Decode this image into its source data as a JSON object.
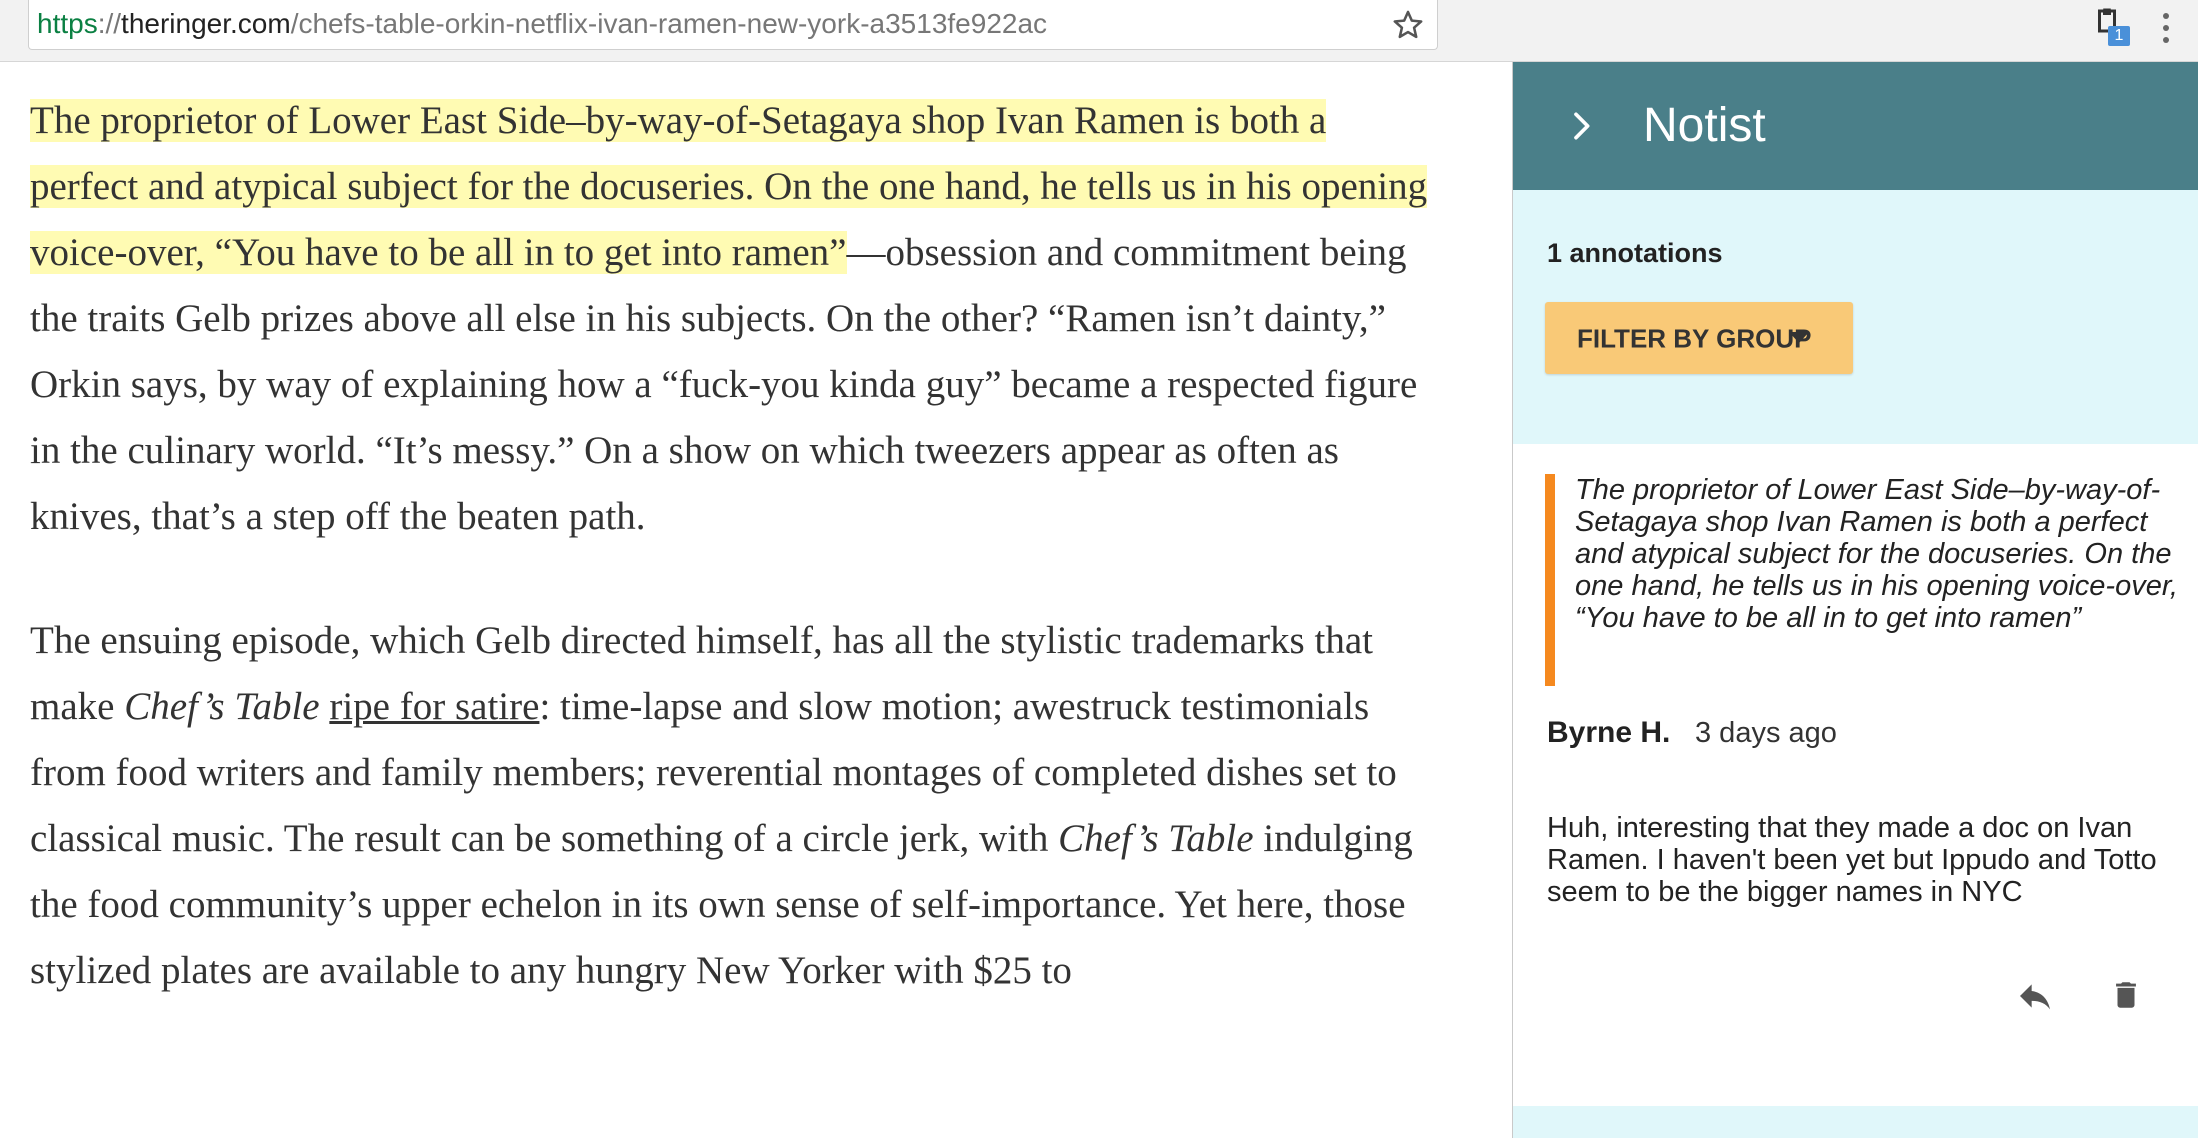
{
  "browser": {
    "url_scheme": "https",
    "url_sep": "://",
    "url_host": "theringer.com",
    "url_path": "/chefs-table-orkin-netflix-ivan-ramen-new-york-a3513fe922ac",
    "extension_badge": "1",
    "icons": [
      "star-icon",
      "extension-icon",
      "menu-icon"
    ]
  },
  "article": {
    "p1_highlight": "The proprietor of Lower East Side–by-way-of-Setagaya shop Ivan Ramen is both a perfect and atypical subject for the docuseries. On the one hand, he tells us in his opening voice-over, “You have to be all in to get into ramen”",
    "p1_rest": "—obsession and commitment being the traits Gelb prizes above all else in his subjects. On the other? “Ramen isn’t dainty,” Orkin says, by way of explaining how a “fuck-you kinda guy” became a respected figure in the culinary world. “It’s messy.” On a show on which tweezers appear as often as knives, that’s a step off the beaten path.",
    "p2_a": "The ensuing episode, which Gelb directed himself, has all the stylistic trademarks that make ",
    "p2_em1": "Chef’s Table",
    "p2_b": " ",
    "p2_link": "ripe for satire",
    "p2_c": ": time-lapse and slow motion; awestruck testimonials from food writers and family members; reverential montages of completed dishes set to classical music. The result can be something of a circle jerk, with ",
    "p2_em2": "Chef’s Table",
    "p2_d": " indulging the food community’s upper echelon in its own sense of self-importance. Yet here, those stylized plates are available to any hungry New Yorker with $25 to"
  },
  "sidebar": {
    "title": "Notist",
    "collapse_icon": "chevron-right-icon",
    "annotation_count": "1 annotations",
    "filter_label": "FILTER BY GROUP",
    "colors": {
      "header": "#4a7f89",
      "background": "#e0f7fa",
      "filter": "#f9c977",
      "quote_bar": "#f5891f"
    },
    "annotation": {
      "quote": "The proprietor of Lower East Side–by-way-of-Setagaya shop Ivan Ramen is both a perfect and atypical subject for the docuseries. On the one hand, he tells us in his opening voice-over, “You have to be all in to get into ramen”",
      "author": "Byrne H.",
      "time": "3 days ago",
      "comment": "Huh, interesting that they made a doc on Ivan Ramen. I haven't been yet but Ippudo and Totto seem to be the bigger names in NYC",
      "actions": [
        "reply-icon",
        "trash-icon"
      ]
    }
  }
}
